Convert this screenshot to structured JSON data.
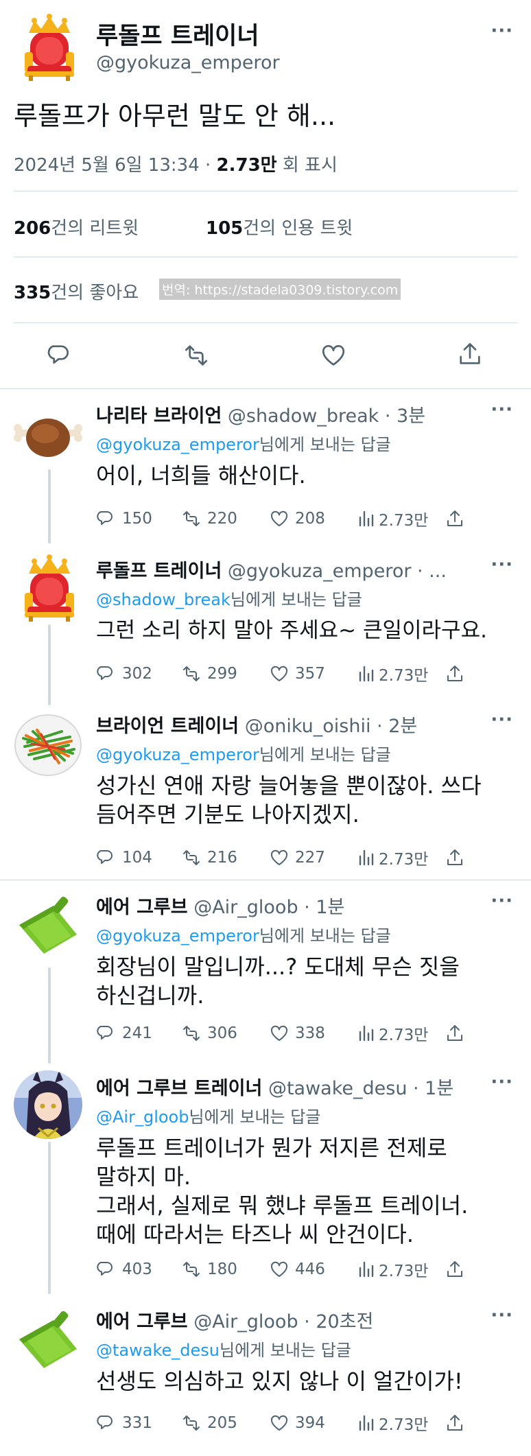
{
  "main_tweet": {
    "author_name": "루돌프 트레이너",
    "author_handle": "@gyokuza_emperor",
    "text": "루돌프가 아무런 말도 안 해...",
    "date": "2024년 5월 6일 13:34",
    "separator": " · ",
    "views_count": "2.73만",
    "views_label": " 회 표시",
    "retweets_count": "206",
    "retweets_label": "건의 리트윗",
    "quotes_count": "105",
    "quotes_label": "건의 인용 트윗",
    "likes_count": "335",
    "likes_label": "건의 좋아요",
    "watermark": "번역: https://stadela0309.tistory.com",
    "more": "···"
  },
  "replies": [
    {
      "name": "나리타 브라이언",
      "meta": "@shadow_break · 3분",
      "to_handle": "@gyokuza_emperor",
      "to_suffix": "님에게 보내는 답글",
      "text": "어이, 너희들 해산이다.",
      "replies": "150",
      "retweets": "220",
      "likes": "208",
      "views": "2.73만",
      "avatar": "meat-icon",
      "more": "···"
    },
    {
      "name": "루돌프 트레이너",
      "meta": "@gyokuza_emperor · ...",
      "to_handle": "@shadow_break",
      "to_suffix": "님에게 보내는 답글",
      "text": "그런 소리 하지 말아 주세요~ 큰일이라구요.",
      "replies": "302",
      "retweets": "299",
      "likes": "357",
      "views": "2.73만",
      "avatar": "throne-icon",
      "more": "···"
    },
    {
      "name": "브라이언 트레이너",
      "meta": "@oniku_oishii · 2분",
      "to_handle": "@gyokuza_emperor",
      "to_suffix": "님에게 보내는 답글",
      "text": "성가신 연애 자랑 늘어놓을 뿐이잖아. 쓰다\n듬어주면 기분도 나아지겠지.",
      "replies": "104",
      "retweets": "216",
      "likes": "227",
      "views": "2.73만",
      "avatar": "vegetable-dish-icon",
      "more": "···"
    },
    {
      "name": "에어 그루브",
      "meta": "@Air_gloob · 1분",
      "to_handle": "@gyokuza_emperor",
      "to_suffix": "님에게 보내는 답글",
      "text": "회장님이 말입니까...? 도대체 무슨 짓을\n하신겁니까.",
      "replies": "241",
      "retweets": "306",
      "likes": "338",
      "views": "2.73만",
      "avatar": "dustpan-icon",
      "more": "···"
    },
    {
      "name": "에어 그루브 트레이너",
      "meta": "@tawake_desu · 1분",
      "to_handle": "@Air_gloob",
      "to_suffix": "님에게 보내는 답글",
      "text": "루돌프 트레이너가 뭔가 저지른 전제로\n말하지 마.\n그래서, 실제로 뭐 했냐 루돌프 트레이너.\n때에 따라서는 타즈나 씨 안건이다.",
      "replies": "403",
      "retweets": "180",
      "likes": "446",
      "views": "2.73만",
      "avatar": "anime-girl-avatar",
      "more": "···"
    },
    {
      "name": "에어 그루브",
      "meta": "@Air_gloob · 20초전",
      "to_handle": "@tawake_desu",
      "to_suffix": "님에게 보내는 답글",
      "text": "선생도 의심하고 있지 않나 이 얼간이가!",
      "replies": "331",
      "retweets": "205",
      "likes": "394",
      "views": "2.73만",
      "avatar": "dustpan-icon",
      "more": "···"
    }
  ],
  "colors": {
    "link": "#1d9bf0",
    "secondary": "#536471",
    "divider": "#cfd9de"
  }
}
